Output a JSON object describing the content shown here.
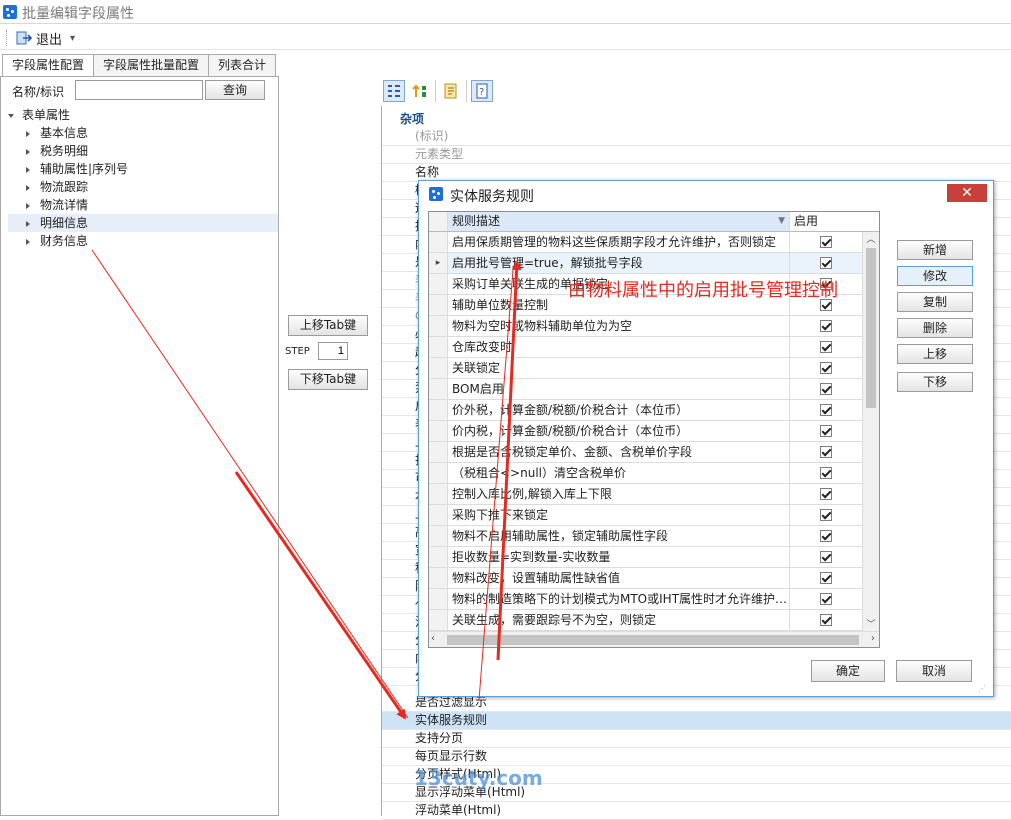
{
  "window": {
    "title": "批量编辑字段属性"
  },
  "toolbar": {
    "exit_label": "退出"
  },
  "tabs": [
    {
      "label": "字段属性配置"
    },
    {
      "label": "字段属性批量配置"
    },
    {
      "label": "列表合计"
    }
  ],
  "search": {
    "label": "名称/标识",
    "value": "",
    "button_label": "查询"
  },
  "tree": {
    "root": "表单属性",
    "items": [
      {
        "label": "基本信息"
      },
      {
        "label": "税务明细"
      },
      {
        "label": "辅助属性|序列号"
      },
      {
        "label": "物流跟踪"
      },
      {
        "label": "物流详情"
      },
      {
        "label": "明细信息"
      },
      {
        "label": "财务信息"
      }
    ]
  },
  "tab_move": {
    "up_label": "上移Tab键",
    "step_label": "STEP",
    "step_value": "1",
    "down_label": "下移Tab键"
  },
  "properties": {
    "section_title": "杂项",
    "top_rows": [
      {
        "label": "(标识)"
      },
      {
        "label": "元素类型"
      },
      {
        "label": "名称"
      }
    ],
    "hidden_rows_left_chars": [
      "植",
      "运",
      "持",
      "内",
      "是",
      "表",
      "表",
      "C",
      "必",
      "超",
      "分",
      "泵",
      "启",
      "表",
      "上",
      "扫",
      "可",
      "本",
      "上",
      "高",
      "宽",
      "科",
      "防",
      "亻",
      "汊",
      "分",
      "内",
      "分"
    ],
    "bottom_rows": [
      {
        "label": "是否过滤显示"
      },
      {
        "label": "实体服务规则"
      },
      {
        "label": "支持分页"
      },
      {
        "label": "每页显示行数"
      },
      {
        "label": "分页样式(Html)"
      },
      {
        "label": "显示浮动菜单(Html)"
      },
      {
        "label": "浮动菜单(Html)"
      }
    ]
  },
  "dialog": {
    "title": "实体服务规则",
    "close_label": "✕",
    "columns": {
      "desc": "规则描述",
      "enabled": "启用"
    },
    "rules": [
      {
        "desc": "启用保质期管理的物料这些保质期字段才允许维护，否则锁定",
        "enabled": true
      },
      {
        "desc": "启用批号管理=true，解锁批号字段",
        "enabled": true
      },
      {
        "desc": "采购订单关联生成的单据锁定",
        "enabled": true
      },
      {
        "desc": "辅助单位数量控制",
        "enabled": true
      },
      {
        "desc": "物料为空时或物料辅助单位为为空",
        "enabled": true
      },
      {
        "desc": "仓库改变时",
        "enabled": true
      },
      {
        "desc": "关联锁定",
        "enabled": true
      },
      {
        "desc": "BOM启用",
        "enabled": true
      },
      {
        "desc": "价外税，计算金额/税额/价税合计（本位币）",
        "enabled": true
      },
      {
        "desc": "价内税，计算金额/税额/价税合计（本位币）",
        "enabled": true
      },
      {
        "desc": "根据是否含税锁定单价、金额、含税单价字段",
        "enabled": true
      },
      {
        "desc": "（税租合<>null）清空含税单价",
        "enabled": true
      },
      {
        "desc": "控制入库比例,解锁入库上下限",
        "enabled": true
      },
      {
        "desc": "采购下推下来锁定",
        "enabled": true
      },
      {
        "desc": "物料不启用辅助属性，锁定辅助属性字段",
        "enabled": true
      },
      {
        "desc": "拒收数量=实到数量-实收数量",
        "enabled": true
      },
      {
        "desc": "物料改变，设置辅助属性缺省值",
        "enabled": true
      },
      {
        "desc": "物料的制造策略下的计划模式为MTO或IHT属性时才允许维护…",
        "enabled": true
      },
      {
        "desc": "关联生成，需要跟踪号不为空，则锁定",
        "enabled": true
      }
    ],
    "buttons": {
      "add": "新增",
      "edit": "修改",
      "copy": "复制",
      "delete": "删除",
      "up": "上移",
      "down": "下移",
      "ok": "确定",
      "cancel": "取消"
    }
  },
  "annotation": {
    "text": "由物料属性中的启用批号管理控制",
    "color": "#e52b21"
  },
  "watermark": {
    "text": "13cuty.com"
  }
}
